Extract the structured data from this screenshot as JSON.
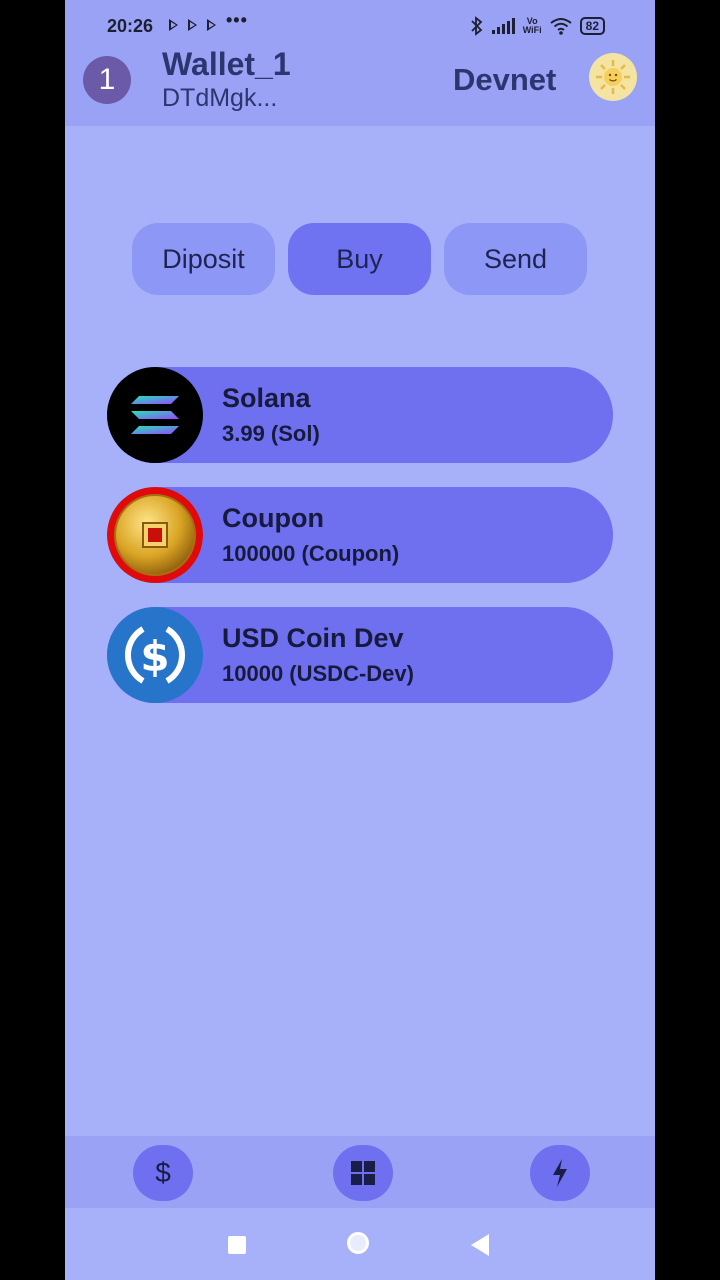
{
  "status": {
    "time": "20:26",
    "dots": "•••",
    "battery": "82",
    "vowifi_top": "Vo",
    "vowifi_bottom": "WiFi"
  },
  "header": {
    "wallet_number": "1",
    "wallet_name": "Wallet_1",
    "wallet_address": "DTdMgk...",
    "network": "Devnet",
    "avatar_icon": "sun-avatar-icon"
  },
  "actions": [
    {
      "label": "Diposit"
    },
    {
      "label": "Buy"
    },
    {
      "label": "Send"
    }
  ],
  "tokens": [
    {
      "name": "Solana",
      "balance": "3.99 (Sol)",
      "icon": "solana-logo-icon"
    },
    {
      "name": "Coupon",
      "balance": "100000 (Coupon)",
      "icon": "coupon-coin-icon"
    },
    {
      "name": "USD Coin Dev",
      "balance": "10000 (USDC-Dev)",
      "icon": "usdc-logo-icon"
    }
  ],
  "bottom_nav": {
    "left_icon": "dollar-icon",
    "left_glyph": "$",
    "center_icon": "grid-icon",
    "right_icon": "lightning-icon"
  },
  "colors": {
    "background": "#a7b1f9",
    "header": "#9aa2f5",
    "accent": "#6e70f0"
  }
}
